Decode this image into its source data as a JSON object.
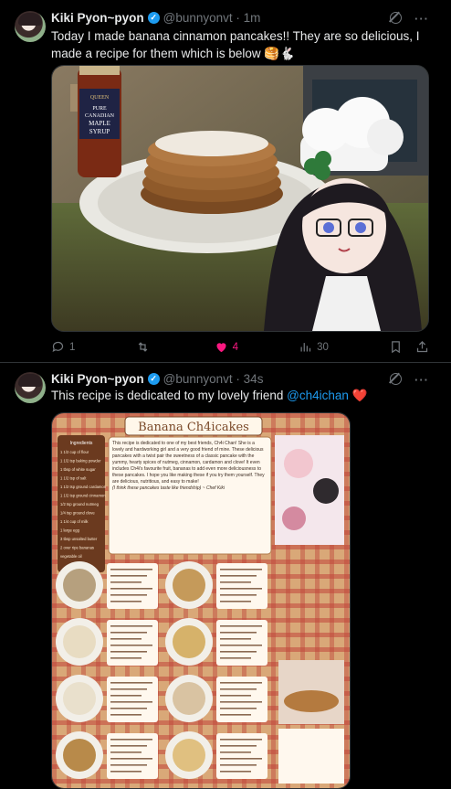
{
  "posts": [
    {
      "author": "Kiki Pyon~pyon",
      "handle": "@bunnyonvt",
      "time": "1m",
      "text": "Today I made banana cinnamon pancakes!! They are so delicious, I made a recipe for them which is below 🥞🐇",
      "media_syrup_label": {
        "brand": "QUEEN",
        "line1": "PURE",
        "line2": "CANADIAN",
        "line3": "MAPLE",
        "line4": "SYRUP"
      },
      "actions": {
        "replies": "1",
        "reposts": "",
        "likes": "4",
        "views": "30"
      }
    },
    {
      "author": "Kiki Pyon~pyon",
      "handle": "@bunnyonvt",
      "time": "34s",
      "text_before": "This recipe is dedicated to my lovely friend ",
      "mention": "@ch4ichan",
      "text_after": " ❤️",
      "recipe": {
        "title": "Banana Ch4icakes",
        "ingredients_title": "Ingredients",
        "ingredients": [
          "1 1/2 cup of flour",
          "1 1/2 tsp baking powder",
          "1 tbsp of white sugar",
          "1 1/2 tsp of salt",
          "1 1/2 tsp ground cardamon",
          "1 1/2 tsp ground cinnamon",
          "1/2 tsp ground nutmeg",
          "1/4 tsp ground clove",
          "1 1/4 cup of milk",
          "1 large egg",
          "3 tbsp unsalted butter",
          "2 over ripe bananas",
          "vegetable oil"
        ],
        "intro": "This recipe is dedicated to one of my best friends, Ch4i Chan! She is a lovely and hardworking girl and a very good friend of mine. These delicious pancakes with a twist pair the sweetness of a classic pancake with the yummy, hearty spices of nutmeg, cinnamon, cardamon and clove! It even includes Ch4i's favourite fruit, bananas to add even more deliciousness to these pancakes. I hope you like making these if you try them yourself. They are delicious, nutritious, and easy to make!",
        "sign": "(I think these pancakes taste like friendship) ~ Chef Kiki"
      }
    }
  ],
  "colors": {
    "accent": "#1d9bf0",
    "like": "#f91880",
    "muted": "#71767b",
    "text": "#e7e9ea"
  }
}
